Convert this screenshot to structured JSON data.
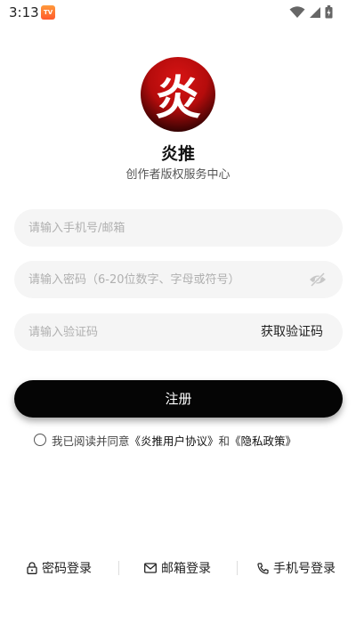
{
  "status_bar": {
    "time": "3:13",
    "notification_icon": "tv-app-icon",
    "notification_text": "TV",
    "icons": [
      "wifi-icon",
      "cell-signal-icon",
      "battery-charging-icon"
    ]
  },
  "brand": {
    "logo_char": "炎",
    "logo_colors": [
      "#d81414",
      "#1a0000"
    ],
    "name": "炎推",
    "subtitle": "创作者版权服务中心"
  },
  "form": {
    "phone_placeholder": "请输入手机号/邮箱",
    "phone_value": "",
    "password_placeholder": "请输入密码（6-20位数字、字母或符号）",
    "password_value": "",
    "code_placeholder": "请输入验证码",
    "code_value": "",
    "get_code_label": "获取验证码",
    "submit_label": "注册"
  },
  "agreement": {
    "prefix": "我已阅读并同意",
    "terms_link": "《炎推用户协议》",
    "conjunction": "和",
    "privacy_link": "《隐私政策》",
    "checked": false
  },
  "bottom_nav": {
    "items": [
      {
        "label": "密码登录",
        "icon": "lock-icon"
      },
      {
        "label": "邮箱登录",
        "icon": "mail-icon"
      },
      {
        "label": "手机号登录",
        "icon": "phone-icon"
      }
    ]
  },
  "colors": {
    "primary_button": "#050505",
    "field_background": "#f5f5f5"
  }
}
